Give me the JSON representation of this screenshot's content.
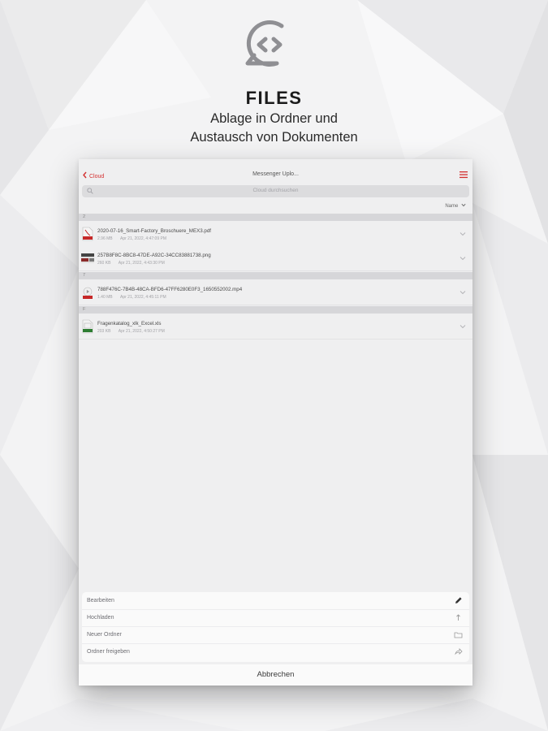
{
  "header": {
    "title": "FILES",
    "subtitle_line1": "Ablage in Ordner und",
    "subtitle_line2": "Austausch von Dokumenten",
    "logo_icon": "chat-bubble-code-icon"
  },
  "navbar": {
    "back_label": "Cloud",
    "title": "Messenger Uplo...",
    "menu_icon": "hamburger-menu-icon",
    "accent_color": "#d32f2f"
  },
  "search": {
    "placeholder": "Cloud durchsuchen"
  },
  "sort": {
    "label": "Name"
  },
  "sections": [
    {
      "letter": "2",
      "files": [
        {
          "name": "2020-07-16_Smart-Factory_Broschuere_MEX3.pdf",
          "size": "2.96 MB",
          "date": "Apr 21, 2022, 4:47:09 PM",
          "type": "pdf"
        },
        {
          "name": "257B8F8C-8BC8-47DE-A92C-34CC83881738.png",
          "size": "260 KB",
          "date": "Apr 21, 2022, 4:43:30 PM",
          "type": "png"
        }
      ]
    },
    {
      "letter": "7",
      "files": [
        {
          "name": "788F476C-7B4B-48CA-BFD6-47FF6280E0F3_1650552002.mp4",
          "size": "1.40 MB",
          "date": "Apr 21, 2022, 4:45:11 PM",
          "type": "mp4"
        }
      ]
    },
    {
      "letter": "F",
      "files": [
        {
          "name": "Fragenkatalog_xlk_Excel.xls",
          "size": "203 KB",
          "date": "Apr 21, 2022, 4:50:27 PM",
          "type": "xls"
        }
      ]
    }
  ],
  "action_sheet": {
    "items": [
      {
        "label": "Bearbeiten",
        "icon": "pencil-icon"
      },
      {
        "label": "Hochladen",
        "icon": "upload-icon"
      },
      {
        "label": "Neuer Ordner",
        "icon": "folder-icon"
      },
      {
        "label": "Ordner freigeben",
        "icon": "share-icon"
      }
    ],
    "cancel_label": "Abbrechen"
  }
}
